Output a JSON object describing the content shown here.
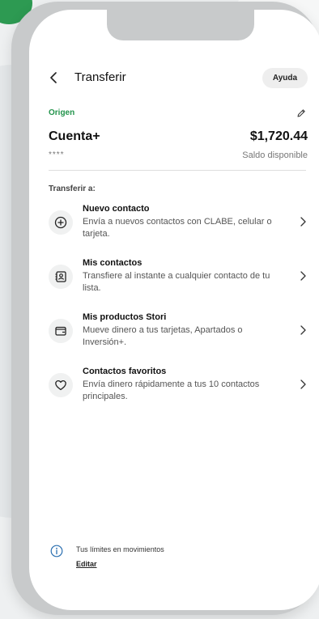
{
  "header": {
    "title": "Transferir",
    "help_label": "Ayuda",
    "back_icon": "chevron-left-icon"
  },
  "origin": {
    "label": "Origen",
    "edit_icon": "pencil-icon",
    "account_name": "Cuenta+",
    "balance": "$1,720.44",
    "masked_number": "****",
    "available_label": "Saldo disponible"
  },
  "transfer_to": {
    "title": "Transferir a:",
    "options": [
      {
        "title": "Nuevo contacto",
        "description": "Envía a nuevos contactos con CLABE, celular o tarjeta.",
        "icon": "plus-circle-icon"
      },
      {
        "title": "Mis contactos",
        "description": "Transfiere al instante a cualquier contacto de tu lista.",
        "icon": "contacts-book-icon"
      },
      {
        "title": "Mis productos Stori",
        "description": "Mueve dinero a tus tarjetas, Apartados o Inversión+.",
        "icon": "wallet-icon"
      },
      {
        "title": "Contactos favoritos",
        "description": "Envía dinero rápidamente a tus 10 contactos principales.",
        "icon": "heart-icon"
      }
    ]
  },
  "limits": {
    "text": "Tus límites en movimientos",
    "link": "Editar",
    "icon": "info-icon"
  },
  "colors": {
    "accent_green": "#23944c",
    "frame": "#c8cacb"
  }
}
